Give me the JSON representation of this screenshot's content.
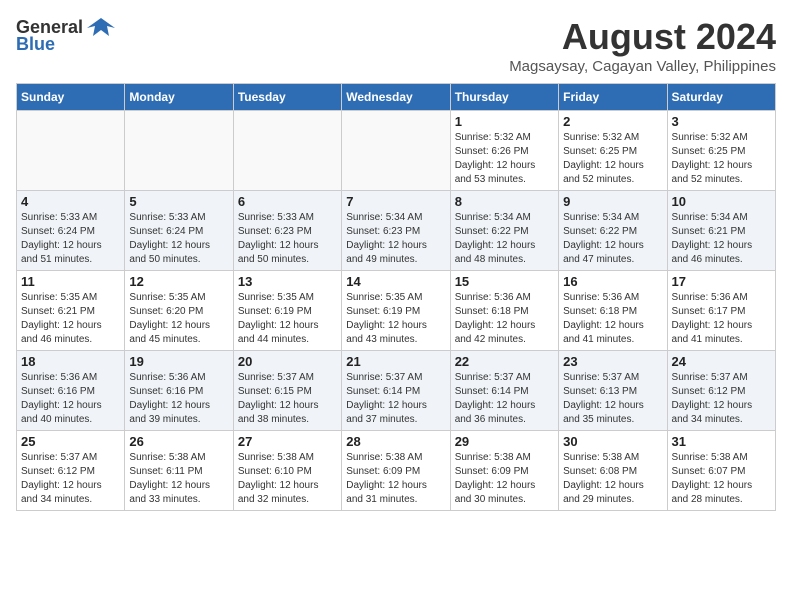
{
  "header": {
    "logo_general": "General",
    "logo_blue": "Blue",
    "month_title": "August 2024",
    "subtitle": "Magsaysay, Cagayan Valley, Philippines"
  },
  "days_of_week": [
    "Sunday",
    "Monday",
    "Tuesday",
    "Wednesday",
    "Thursday",
    "Friday",
    "Saturday"
  ],
  "weeks": [
    [
      {
        "day": "",
        "sunrise": "",
        "sunset": "",
        "daylight": ""
      },
      {
        "day": "",
        "sunrise": "",
        "sunset": "",
        "daylight": ""
      },
      {
        "day": "",
        "sunrise": "",
        "sunset": "",
        "daylight": ""
      },
      {
        "day": "",
        "sunrise": "",
        "sunset": "",
        "daylight": ""
      },
      {
        "day": "1",
        "sunrise": "5:32 AM",
        "sunset": "6:26 PM",
        "daylight": "12 hours and 53 minutes."
      },
      {
        "day": "2",
        "sunrise": "5:32 AM",
        "sunset": "6:25 PM",
        "daylight": "12 hours and 52 minutes."
      },
      {
        "day": "3",
        "sunrise": "5:32 AM",
        "sunset": "6:25 PM",
        "daylight": "12 hours and 52 minutes."
      }
    ],
    [
      {
        "day": "4",
        "sunrise": "5:33 AM",
        "sunset": "6:24 PM",
        "daylight": "12 hours and 51 minutes."
      },
      {
        "day": "5",
        "sunrise": "5:33 AM",
        "sunset": "6:24 PM",
        "daylight": "12 hours and 50 minutes."
      },
      {
        "day": "6",
        "sunrise": "5:33 AM",
        "sunset": "6:23 PM",
        "daylight": "12 hours and 50 minutes."
      },
      {
        "day": "7",
        "sunrise": "5:34 AM",
        "sunset": "6:23 PM",
        "daylight": "12 hours and 49 minutes."
      },
      {
        "day": "8",
        "sunrise": "5:34 AM",
        "sunset": "6:22 PM",
        "daylight": "12 hours and 48 minutes."
      },
      {
        "day": "9",
        "sunrise": "5:34 AM",
        "sunset": "6:22 PM",
        "daylight": "12 hours and 47 minutes."
      },
      {
        "day": "10",
        "sunrise": "5:34 AM",
        "sunset": "6:21 PM",
        "daylight": "12 hours and 46 minutes."
      }
    ],
    [
      {
        "day": "11",
        "sunrise": "5:35 AM",
        "sunset": "6:21 PM",
        "daylight": "12 hours and 46 minutes."
      },
      {
        "day": "12",
        "sunrise": "5:35 AM",
        "sunset": "6:20 PM",
        "daylight": "12 hours and 45 minutes."
      },
      {
        "day": "13",
        "sunrise": "5:35 AM",
        "sunset": "6:19 PM",
        "daylight": "12 hours and 44 minutes."
      },
      {
        "day": "14",
        "sunrise": "5:35 AM",
        "sunset": "6:19 PM",
        "daylight": "12 hours and 43 minutes."
      },
      {
        "day": "15",
        "sunrise": "5:36 AM",
        "sunset": "6:18 PM",
        "daylight": "12 hours and 42 minutes."
      },
      {
        "day": "16",
        "sunrise": "5:36 AM",
        "sunset": "6:18 PM",
        "daylight": "12 hours and 41 minutes."
      },
      {
        "day": "17",
        "sunrise": "5:36 AM",
        "sunset": "6:17 PM",
        "daylight": "12 hours and 41 minutes."
      }
    ],
    [
      {
        "day": "18",
        "sunrise": "5:36 AM",
        "sunset": "6:16 PM",
        "daylight": "12 hours and 40 minutes."
      },
      {
        "day": "19",
        "sunrise": "5:36 AM",
        "sunset": "6:16 PM",
        "daylight": "12 hours and 39 minutes."
      },
      {
        "day": "20",
        "sunrise": "5:37 AM",
        "sunset": "6:15 PM",
        "daylight": "12 hours and 38 minutes."
      },
      {
        "day": "21",
        "sunrise": "5:37 AM",
        "sunset": "6:14 PM",
        "daylight": "12 hours and 37 minutes."
      },
      {
        "day": "22",
        "sunrise": "5:37 AM",
        "sunset": "6:14 PM",
        "daylight": "12 hours and 36 minutes."
      },
      {
        "day": "23",
        "sunrise": "5:37 AM",
        "sunset": "6:13 PM",
        "daylight": "12 hours and 35 minutes."
      },
      {
        "day": "24",
        "sunrise": "5:37 AM",
        "sunset": "6:12 PM",
        "daylight": "12 hours and 34 minutes."
      }
    ],
    [
      {
        "day": "25",
        "sunrise": "5:37 AM",
        "sunset": "6:12 PM",
        "daylight": "12 hours and 34 minutes."
      },
      {
        "day": "26",
        "sunrise": "5:38 AM",
        "sunset": "6:11 PM",
        "daylight": "12 hours and 33 minutes."
      },
      {
        "day": "27",
        "sunrise": "5:38 AM",
        "sunset": "6:10 PM",
        "daylight": "12 hours and 32 minutes."
      },
      {
        "day": "28",
        "sunrise": "5:38 AM",
        "sunset": "6:09 PM",
        "daylight": "12 hours and 31 minutes."
      },
      {
        "day": "29",
        "sunrise": "5:38 AM",
        "sunset": "6:09 PM",
        "daylight": "12 hours and 30 minutes."
      },
      {
        "day": "30",
        "sunrise": "5:38 AM",
        "sunset": "6:08 PM",
        "daylight": "12 hours and 29 minutes."
      },
      {
        "day": "31",
        "sunrise": "5:38 AM",
        "sunset": "6:07 PM",
        "daylight": "12 hours and 28 minutes."
      }
    ]
  ]
}
